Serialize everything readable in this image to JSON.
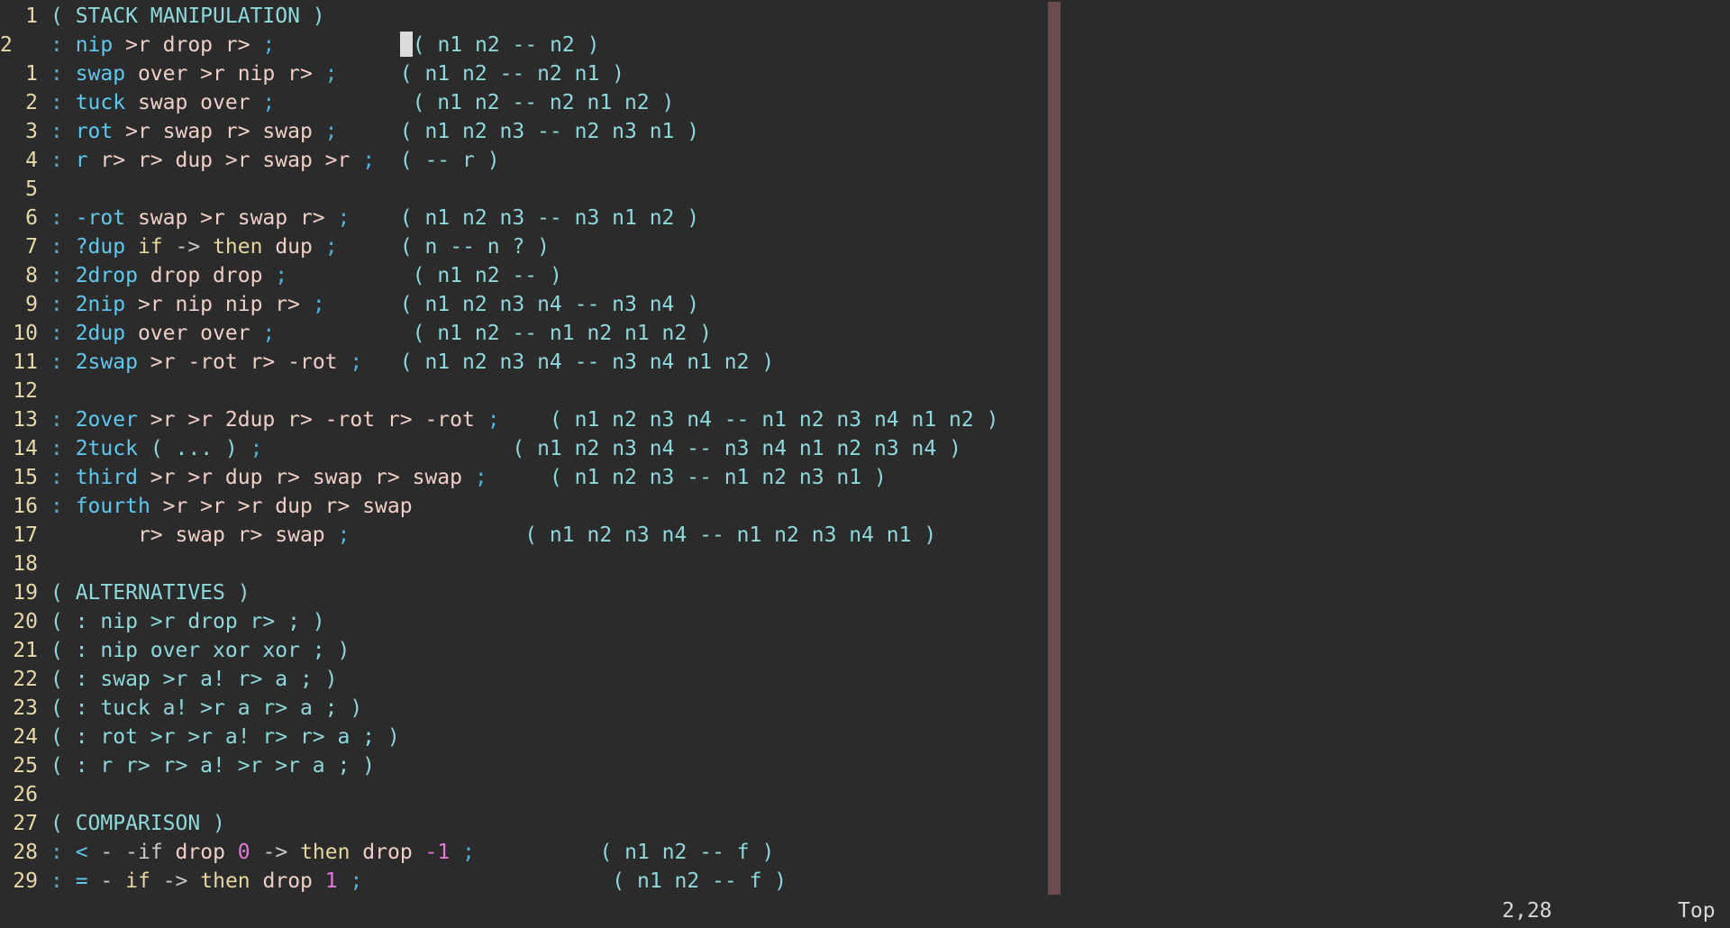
{
  "editor": {
    "cursor": {
      "line": 2,
      "column": 28
    },
    "lines": [
      {
        "num": "1",
        "kind": "rel",
        "tokens": [
          [
            "comment",
            "( STACK MANIPULATION )"
          ]
        ]
      },
      {
        "num": "2",
        "kind": "cur",
        "tokens": [
          [
            "colon",
            ": "
          ],
          [
            "name",
            "nip"
          ],
          [
            "word",
            " >r drop r> "
          ],
          [
            "colon",
            ";"
          ],
          [
            "plain",
            "          "
          ],
          [
            "cursor",
            ""
          ],
          [
            "comment",
            "( n1 n2 -- n2 )"
          ]
        ]
      },
      {
        "num": "1",
        "kind": "rel",
        "tokens": [
          [
            "colon",
            ": "
          ],
          [
            "name",
            "swap"
          ],
          [
            "word",
            " over >r nip r> "
          ],
          [
            "colon",
            ";"
          ],
          [
            "plain",
            "     "
          ],
          [
            "comment",
            "( n1 n2 -- n2 n1 )"
          ]
        ]
      },
      {
        "num": "2",
        "kind": "rel",
        "tokens": [
          [
            "colon",
            ": "
          ],
          [
            "name",
            "tuck"
          ],
          [
            "word",
            " swap over "
          ],
          [
            "colon",
            ";"
          ],
          [
            "plain",
            "           "
          ],
          [
            "comment",
            "( n1 n2 -- n2 n1 n2 )"
          ]
        ]
      },
      {
        "num": "3",
        "kind": "rel",
        "tokens": [
          [
            "colon",
            ": "
          ],
          [
            "name",
            "rot"
          ],
          [
            "word",
            " >r swap r> swap "
          ],
          [
            "colon",
            ";"
          ],
          [
            "plain",
            "     "
          ],
          [
            "comment",
            "( n1 n2 n3 -- n2 n3 n1 )"
          ]
        ]
      },
      {
        "num": "4",
        "kind": "rel",
        "tokens": [
          [
            "colon",
            ": "
          ],
          [
            "name",
            "r"
          ],
          [
            "word",
            " r> r> dup >r swap >r "
          ],
          [
            "colon",
            ";"
          ],
          [
            "plain",
            "  "
          ],
          [
            "comment",
            "( -- r )"
          ]
        ]
      },
      {
        "num": "5",
        "kind": "rel",
        "tokens": []
      },
      {
        "num": "6",
        "kind": "rel",
        "tokens": [
          [
            "colon",
            ": "
          ],
          [
            "name",
            "-rot"
          ],
          [
            "word",
            " swap >r swap r> "
          ],
          [
            "colon",
            ";"
          ],
          [
            "plain",
            "    "
          ],
          [
            "comment",
            "( n1 n2 n3 -- n3 n1 n2 )"
          ]
        ]
      },
      {
        "num": "7",
        "kind": "rel",
        "tokens": [
          [
            "colon",
            ": "
          ],
          [
            "name",
            "?dup"
          ],
          [
            "plain",
            " "
          ],
          [
            "kw",
            "if"
          ],
          [
            "plain",
            " "
          ],
          [
            "op",
            "->"
          ],
          [
            "plain",
            " "
          ],
          [
            "kw",
            "then"
          ],
          [
            "word",
            " dup "
          ],
          [
            "colon",
            ";"
          ],
          [
            "plain",
            "     "
          ],
          [
            "comment",
            "( n -- n ? )"
          ]
        ]
      },
      {
        "num": "8",
        "kind": "rel",
        "tokens": [
          [
            "colon",
            ": "
          ],
          [
            "name",
            "2drop"
          ],
          [
            "word",
            " drop drop "
          ],
          [
            "colon",
            ";"
          ],
          [
            "plain",
            "          "
          ],
          [
            "comment",
            "( n1 n2 -- )"
          ]
        ]
      },
      {
        "num": "9",
        "kind": "rel",
        "tokens": [
          [
            "colon",
            ": "
          ],
          [
            "name",
            "2nip"
          ],
          [
            "word",
            " >r nip nip r> "
          ],
          [
            "colon",
            ";"
          ],
          [
            "plain",
            "      "
          ],
          [
            "comment",
            "( n1 n2 n3 n4 -- n3 n4 )"
          ]
        ]
      },
      {
        "num": "10",
        "kind": "rel",
        "tokens": [
          [
            "colon",
            ": "
          ],
          [
            "name",
            "2dup"
          ],
          [
            "word",
            " over over "
          ],
          [
            "colon",
            ";"
          ],
          [
            "plain",
            "           "
          ],
          [
            "comment",
            "( n1 n2 -- n1 n2 n1 n2 )"
          ]
        ]
      },
      {
        "num": "11",
        "kind": "rel",
        "tokens": [
          [
            "colon",
            ": "
          ],
          [
            "name",
            "2swap"
          ],
          [
            "word",
            " >r -rot r> -rot "
          ],
          [
            "colon",
            ";"
          ],
          [
            "plain",
            "   "
          ],
          [
            "comment",
            "( n1 n2 n3 n4 -- n3 n4 n1 n2 )"
          ]
        ]
      },
      {
        "num": "12",
        "kind": "rel",
        "tokens": []
      },
      {
        "num": "13",
        "kind": "rel",
        "tokens": [
          [
            "colon",
            ": "
          ],
          [
            "name",
            "2over"
          ],
          [
            "word",
            " >r >r 2dup r> -rot r> -rot "
          ],
          [
            "colon",
            ";"
          ],
          [
            "plain",
            "    "
          ],
          [
            "comment",
            "( n1 n2 n3 n4 -- n1 n2 n3 n4 n1 n2 )"
          ]
        ]
      },
      {
        "num": "14",
        "kind": "rel",
        "tokens": [
          [
            "colon",
            ": "
          ],
          [
            "name",
            "2tuck"
          ],
          [
            "plain",
            " "
          ],
          [
            "comment",
            "( ... )"
          ],
          [
            "plain",
            " "
          ],
          [
            "colon",
            ";"
          ],
          [
            "plain",
            "                    "
          ],
          [
            "comment",
            "( n1 n2 n3 n4 -- n3 n4 n1 n2 n3 n4 )"
          ]
        ]
      },
      {
        "num": "15",
        "kind": "rel",
        "tokens": [
          [
            "colon",
            ": "
          ],
          [
            "name",
            "third"
          ],
          [
            "word",
            " >r >r dup r> swap r> swap "
          ],
          [
            "colon",
            ";"
          ],
          [
            "plain",
            "     "
          ],
          [
            "comment",
            "( n1 n2 n3 -- n1 n2 n3 n1 )"
          ]
        ]
      },
      {
        "num": "16",
        "kind": "rel",
        "tokens": [
          [
            "colon",
            ": "
          ],
          [
            "name",
            "fourth"
          ],
          [
            "word",
            " >r >r >r dup r> swap"
          ]
        ]
      },
      {
        "num": "17",
        "kind": "rel",
        "tokens": [
          [
            "plain",
            "       "
          ],
          [
            "word",
            "r> swap r> swap "
          ],
          [
            "colon",
            ";"
          ],
          [
            "plain",
            "              "
          ],
          [
            "comment",
            "( n1 n2 n3 n4 -- n1 n2 n3 n4 n1 )"
          ]
        ]
      },
      {
        "num": "18",
        "kind": "rel",
        "tokens": []
      },
      {
        "num": "19",
        "kind": "rel",
        "tokens": [
          [
            "comment",
            "( ALTERNATIVES )"
          ]
        ]
      },
      {
        "num": "20",
        "kind": "rel",
        "tokens": [
          [
            "comment",
            "( : nip >r drop r> ; )"
          ]
        ]
      },
      {
        "num": "21",
        "kind": "rel",
        "tokens": [
          [
            "comment",
            "( : nip over xor xor ; )"
          ]
        ]
      },
      {
        "num": "22",
        "kind": "rel",
        "tokens": [
          [
            "comment",
            "( : swap >r a! r> a ; )"
          ]
        ]
      },
      {
        "num": "23",
        "kind": "rel",
        "tokens": [
          [
            "comment",
            "( : tuck a! >r a r> a ; )"
          ]
        ]
      },
      {
        "num": "24",
        "kind": "rel",
        "tokens": [
          [
            "comment",
            "( : rot >r >r a! r> r> a ; )"
          ]
        ]
      },
      {
        "num": "25",
        "kind": "rel",
        "tokens": [
          [
            "comment",
            "( : r r> r> a! >r >r a ; )"
          ]
        ]
      },
      {
        "num": "26",
        "kind": "rel",
        "tokens": []
      },
      {
        "num": "27",
        "kind": "rel",
        "tokens": [
          [
            "comment",
            "( COMPARISON )"
          ]
        ]
      },
      {
        "num": "28",
        "kind": "rel",
        "tokens": [
          [
            "colon",
            ": "
          ],
          [
            "name",
            "<"
          ],
          [
            "plain",
            " "
          ],
          [
            "op",
            "-"
          ],
          [
            "plain",
            " "
          ],
          [
            "op",
            "-if"
          ],
          [
            "word",
            " drop "
          ],
          [
            "num",
            "0"
          ],
          [
            "plain",
            " "
          ],
          [
            "op",
            "->"
          ],
          [
            "plain",
            " "
          ],
          [
            "kw",
            "then"
          ],
          [
            "word",
            " drop "
          ],
          [
            "num",
            "-1"
          ],
          [
            "plain",
            " "
          ],
          [
            "colon",
            ";"
          ],
          [
            "plain",
            "          "
          ],
          [
            "comment",
            "( n1 n2 -- f )"
          ]
        ]
      },
      {
        "num": "29",
        "kind": "rel",
        "tokens": [
          [
            "colon",
            ": "
          ],
          [
            "name",
            "="
          ],
          [
            "plain",
            " "
          ],
          [
            "op",
            "-"
          ],
          [
            "plain",
            " "
          ],
          [
            "kw",
            "if"
          ],
          [
            "plain",
            " "
          ],
          [
            "op",
            "->"
          ],
          [
            "plain",
            " "
          ],
          [
            "kw",
            "then"
          ],
          [
            "word",
            " drop "
          ],
          [
            "num",
            "1"
          ],
          [
            "plain",
            " "
          ],
          [
            "colon",
            ";"
          ],
          [
            "plain",
            "                    "
          ],
          [
            "comment",
            "( n1 n2 -- f )"
          ]
        ]
      }
    ]
  },
  "statusline": {
    "position": "2,28",
    "scroll": "Top"
  },
  "colors": {
    "background": "#2b2b2b",
    "line_number": "#e8d9a8",
    "definition_name": "#5fc8ee",
    "punctuation": "#4fb0d8",
    "word": "#f0cfc7",
    "comment": "#8fd8dc",
    "keyword": "#e6d6a0",
    "operator": "#c8c8c8",
    "number": "#e07ad8",
    "color_column": "#6b4c4c"
  }
}
